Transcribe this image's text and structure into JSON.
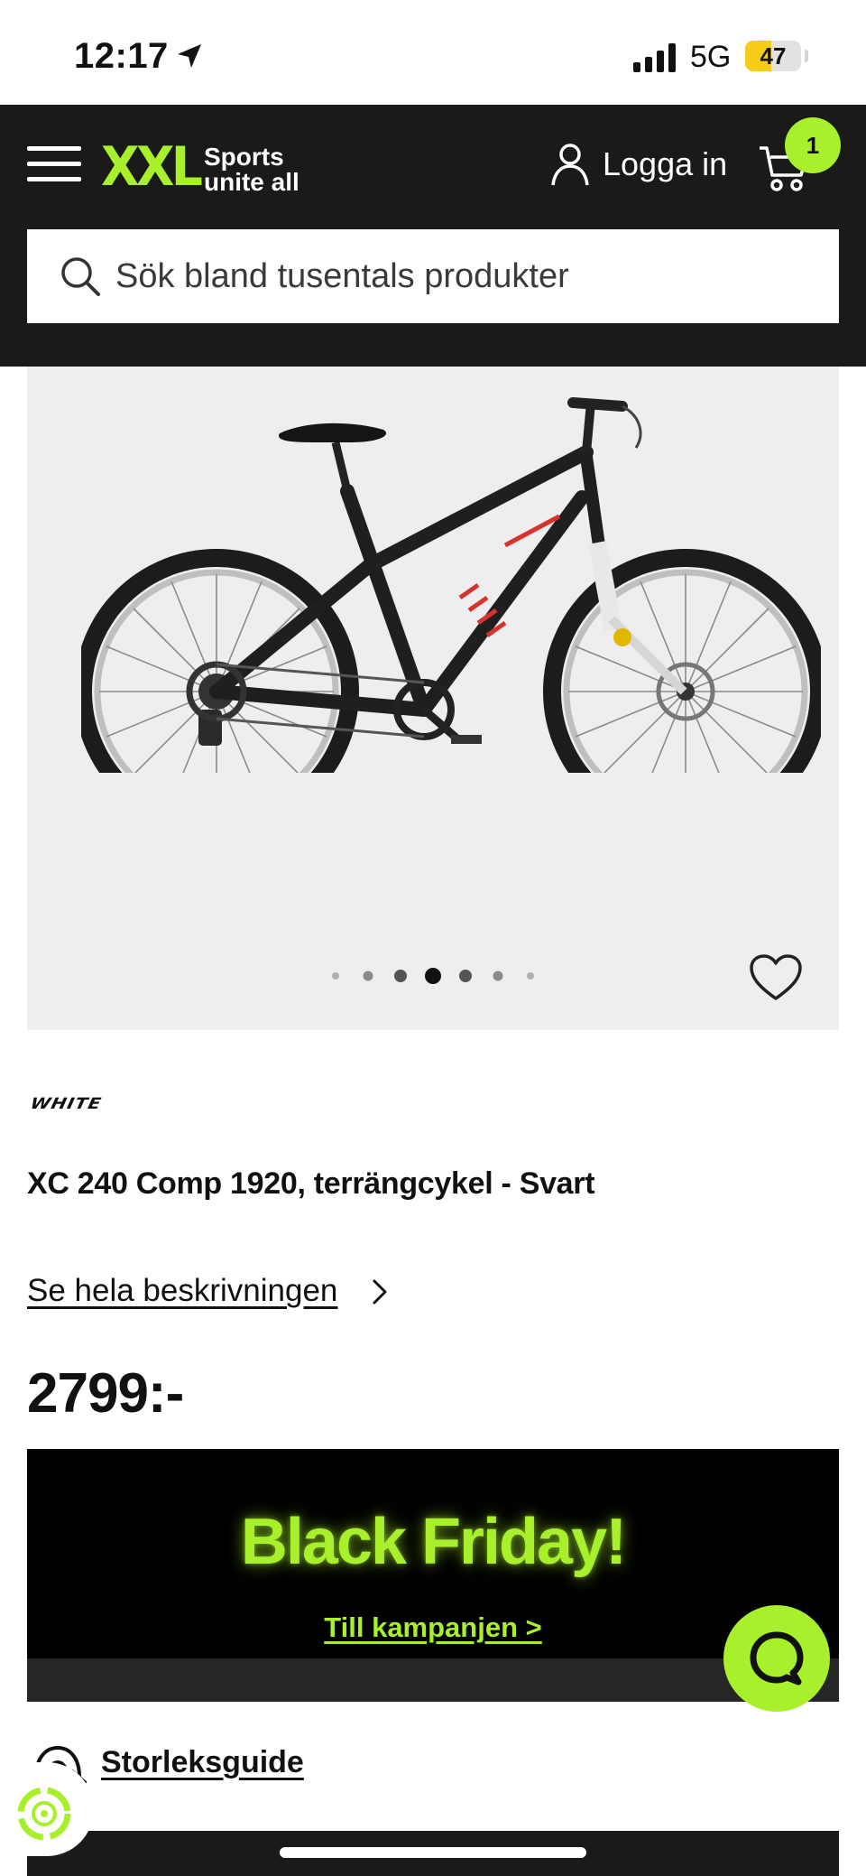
{
  "status_bar": {
    "time": "12:17",
    "network": "5G",
    "battery": "47",
    "battery_level": 0.47,
    "location_icon": "location-arrow-icon",
    "signal_icon": "cellular-signal-icon"
  },
  "header": {
    "logo_main": "XXL",
    "logo_tagline_1": "Sports",
    "logo_tagline_2": "unite all",
    "login_label": "Logga in",
    "cart_count": "1",
    "search_placeholder": "Sök bland tusentals produkter",
    "menu_icon": "hamburger-menu-icon",
    "user_icon": "user-icon",
    "cart_icon": "shopping-cart-icon",
    "search_icon": "search-icon"
  },
  "gallery": {
    "image_alt": "bike-image",
    "dot_count": 7,
    "active_index": 3,
    "favorite_icon": "heart-icon"
  },
  "product": {
    "brand": "WHITE",
    "title": "XC 240 Comp 1920, terrängcykel - Svart",
    "description_link": "Se hela beskrivningen",
    "price": "2799:-"
  },
  "promo": {
    "title": "Black Friday!",
    "link": "Till kampanjen >"
  },
  "size_guide": {
    "label": "Storleksguide",
    "icon": "size-guide-icon"
  },
  "chat": {
    "icon": "chat-icon"
  },
  "eco": {
    "icon": "eco-badge-icon"
  },
  "colors": {
    "brand_green": "#a8f02b",
    "header_bg": "#1a1a1a",
    "gallery_bg": "#eeeef0",
    "bike_accent": "#d8322c"
  }
}
